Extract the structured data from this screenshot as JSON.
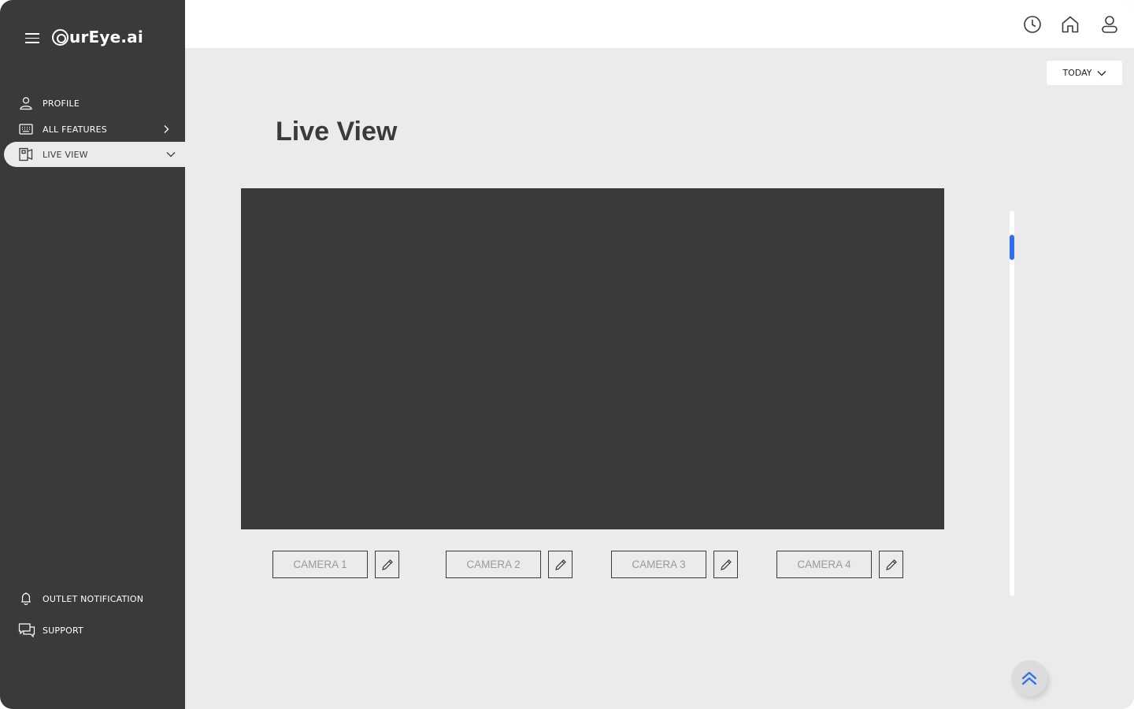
{
  "app": {
    "logo_text": "urEye.ai"
  },
  "sidebar": {
    "items": [
      {
        "label": "PROFILE",
        "icon": "user-icon"
      },
      {
        "label": "ALL FEATURES",
        "icon": "keyboard-icon"
      },
      {
        "label": "LIVE VIEW",
        "icon": "camera-view-icon",
        "active": true
      }
    ],
    "bottom_items": [
      {
        "label": "OUTLET NOTIFICATION",
        "icon": "bell-icon"
      },
      {
        "label": "SUPPORT",
        "icon": "chat-icon"
      }
    ]
  },
  "header": {
    "icons": [
      "history-icon",
      "home-icon",
      "user-icon"
    ]
  },
  "filter": {
    "label": "TODAY"
  },
  "main": {
    "title": "Live View",
    "cameras": [
      {
        "label": "CAMERA 1"
      },
      {
        "label": "CAMERA 2"
      },
      {
        "label": "CAMERA 3"
      },
      {
        "label": "CAMERA 4"
      }
    ]
  },
  "colors": {
    "sidebar_bg": "#3a3a3a",
    "main_bg": "#ebebeb",
    "accent": "#2f6fef"
  }
}
